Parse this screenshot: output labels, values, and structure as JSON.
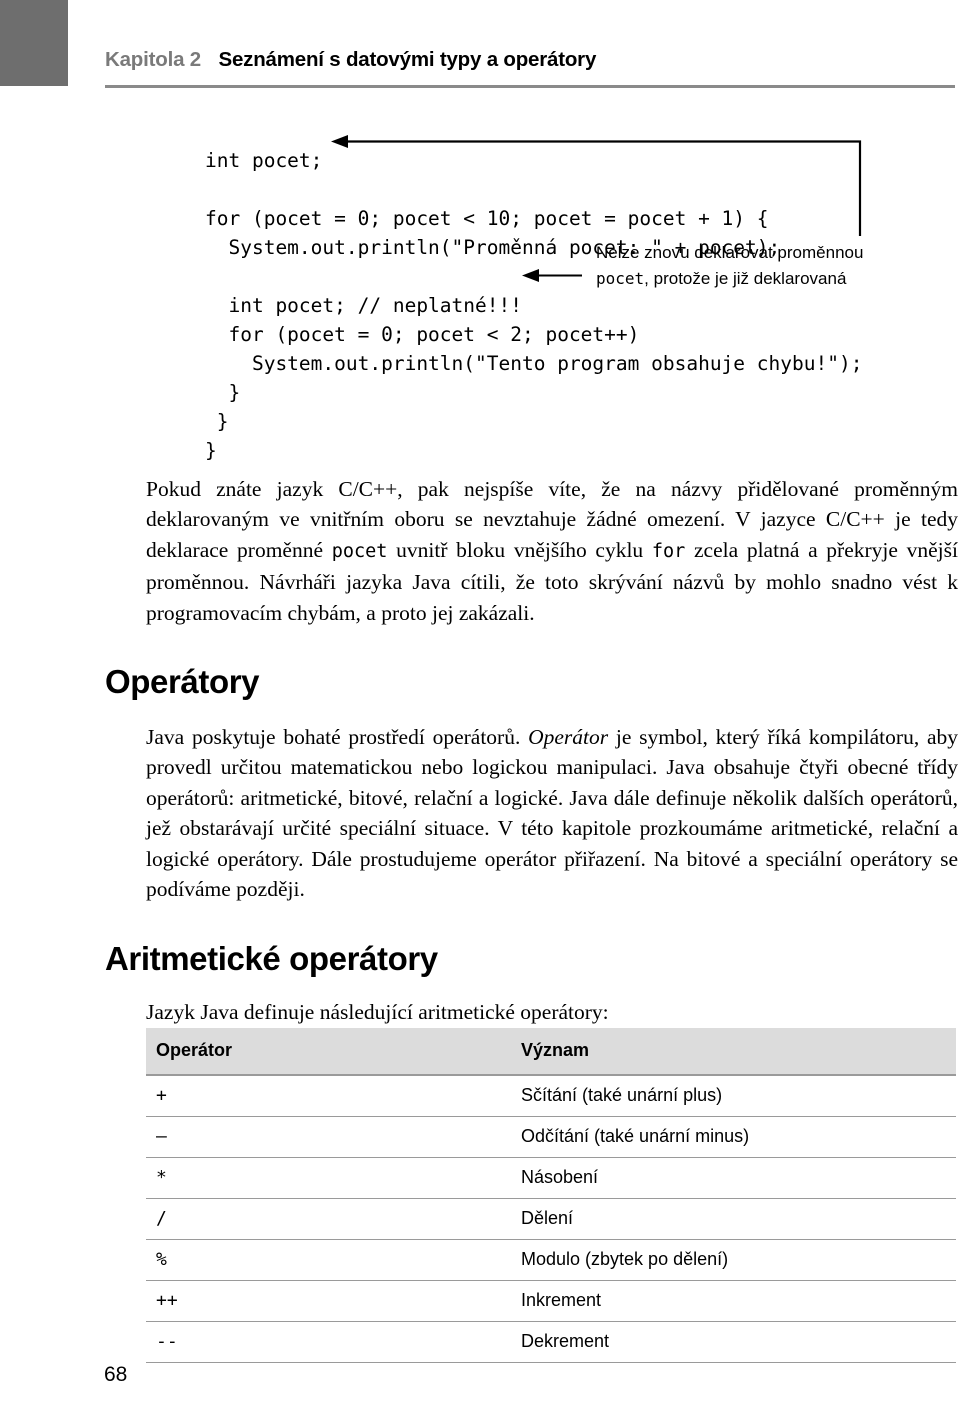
{
  "header": {
    "chapter": "Kapitola 2",
    "title": "Seznámení s datovými typy a operátory"
  },
  "code_listing": {
    "text": "int pocet;\n\nfor (pocet = 0; pocet < 10; pocet = pocet + 1) {\n  System.out.println(\"Proměnná pocet: \" + pocet);\n\n  int pocet; // neplatné!!!\n  for (pocet = 0; pocet < 2; pocet++)\n    System.out.println(\"Tento program obsahuje chybu!\");\n  }\n }\n}"
  },
  "callout": {
    "line1": "Nelze znovu deklarovat proměnnou",
    "line2_code": "pocet",
    "line2_rest": ", protože je již deklarovaná"
  },
  "paragraphs": {
    "scope": {
      "p1": "Pokud znáte jazyk C/C++, pak nejspíše víte, že na názvy přidělované proměnným deklarovaným ve vnitřním oboru se nevztahuje žádné omezení. V jazyce C/C++ je tedy deklarace proměnné ",
      "code1": "pocet",
      "p2": " uvnitř bloku vnějšího cyklu ",
      "code2": "for",
      "p3": " zcela platná a překryje vnější proměnnou. Návrháři jazyka Java cítili, že toto skrývání názvů by mohlo snadno vést k programovacím chybám, a proto jej zakázali."
    },
    "operators": {
      "p1": "Java poskytuje bohaté prostředí operátorů. ",
      "em1": "Operátor",
      "p2": " je symbol, který říká kompilátoru, aby provedl určitou matematickou nebo logickou manipulaci. Java obsahuje čtyři obecné třídy operátorů: aritmetické, bitové, relační a logické. Java dále definuje několik dalších operátorů, jež obstarávají určité speciální situace. V této kapitole prozkoumáme aritmetické, relační a logické operátory. Dále prostudujeme operátor přiřazení. Na bitové a speciální operátory se podíváme později."
    },
    "arithmetic_intro": "Jazyk Java definuje následující aritmetické operátory:"
  },
  "headings": {
    "operatory": "Operátory",
    "aritmeticke_operatory": "Aritmetické operátory"
  },
  "table": {
    "columns": [
      "Operátor",
      "Význam"
    ],
    "rows": [
      {
        "operator": "+",
        "meaning": "Sčítání (také unární plus)"
      },
      {
        "operator": "–",
        "meaning": "Odčítání (také unární minus)"
      },
      {
        "operator": "*",
        "meaning": "Násobení"
      },
      {
        "operator": "/",
        "meaning": "Dělení"
      },
      {
        "operator": "%",
        "meaning": "Modulo (zbytek po dělení)"
      },
      {
        "operator": "++",
        "meaning": "Inkrement"
      },
      {
        "operator": "--",
        "meaning": "Dekrement"
      }
    ]
  },
  "footer": {
    "page_number": "68"
  },
  "colors": {
    "header_block": "#6e6e6e",
    "header_rule": "#8a8a8a",
    "chapter_label": "#7a7a7a",
    "table_header_bg": "#dcdcdc",
    "table_border": "#9a9a9a"
  }
}
